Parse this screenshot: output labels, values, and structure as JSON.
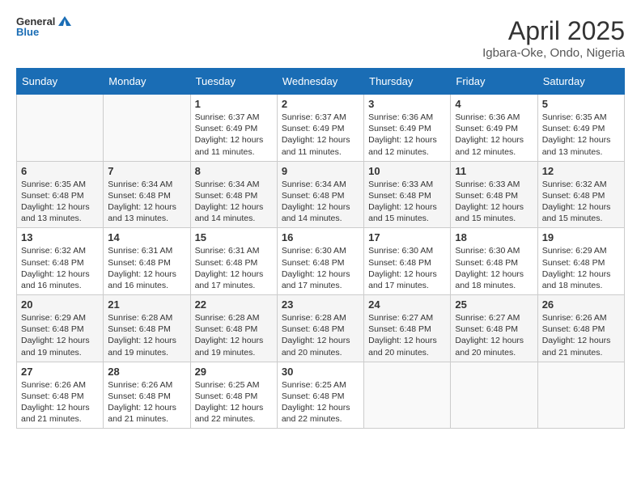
{
  "header": {
    "logo_line1": "General",
    "logo_line2": "Blue",
    "month_title": "April 2025",
    "subtitle": "Igbara-Oke, Ondo, Nigeria"
  },
  "weekdays": [
    "Sunday",
    "Monday",
    "Tuesday",
    "Wednesday",
    "Thursday",
    "Friday",
    "Saturday"
  ],
  "weeks": [
    [
      {
        "day": "",
        "info": ""
      },
      {
        "day": "",
        "info": ""
      },
      {
        "day": "1",
        "info": "Sunrise: 6:37 AM\nSunset: 6:49 PM\nDaylight: 12 hours and 11 minutes."
      },
      {
        "day": "2",
        "info": "Sunrise: 6:37 AM\nSunset: 6:49 PM\nDaylight: 12 hours and 11 minutes."
      },
      {
        "day": "3",
        "info": "Sunrise: 6:36 AM\nSunset: 6:49 PM\nDaylight: 12 hours and 12 minutes."
      },
      {
        "day": "4",
        "info": "Sunrise: 6:36 AM\nSunset: 6:49 PM\nDaylight: 12 hours and 12 minutes."
      },
      {
        "day": "5",
        "info": "Sunrise: 6:35 AM\nSunset: 6:49 PM\nDaylight: 12 hours and 13 minutes."
      }
    ],
    [
      {
        "day": "6",
        "info": "Sunrise: 6:35 AM\nSunset: 6:48 PM\nDaylight: 12 hours and 13 minutes."
      },
      {
        "day": "7",
        "info": "Sunrise: 6:34 AM\nSunset: 6:48 PM\nDaylight: 12 hours and 13 minutes."
      },
      {
        "day": "8",
        "info": "Sunrise: 6:34 AM\nSunset: 6:48 PM\nDaylight: 12 hours and 14 minutes."
      },
      {
        "day": "9",
        "info": "Sunrise: 6:34 AM\nSunset: 6:48 PM\nDaylight: 12 hours and 14 minutes."
      },
      {
        "day": "10",
        "info": "Sunrise: 6:33 AM\nSunset: 6:48 PM\nDaylight: 12 hours and 15 minutes."
      },
      {
        "day": "11",
        "info": "Sunrise: 6:33 AM\nSunset: 6:48 PM\nDaylight: 12 hours and 15 minutes."
      },
      {
        "day": "12",
        "info": "Sunrise: 6:32 AM\nSunset: 6:48 PM\nDaylight: 12 hours and 15 minutes."
      }
    ],
    [
      {
        "day": "13",
        "info": "Sunrise: 6:32 AM\nSunset: 6:48 PM\nDaylight: 12 hours and 16 minutes."
      },
      {
        "day": "14",
        "info": "Sunrise: 6:31 AM\nSunset: 6:48 PM\nDaylight: 12 hours and 16 minutes."
      },
      {
        "day": "15",
        "info": "Sunrise: 6:31 AM\nSunset: 6:48 PM\nDaylight: 12 hours and 17 minutes."
      },
      {
        "day": "16",
        "info": "Sunrise: 6:30 AM\nSunset: 6:48 PM\nDaylight: 12 hours and 17 minutes."
      },
      {
        "day": "17",
        "info": "Sunrise: 6:30 AM\nSunset: 6:48 PM\nDaylight: 12 hours and 17 minutes."
      },
      {
        "day": "18",
        "info": "Sunrise: 6:30 AM\nSunset: 6:48 PM\nDaylight: 12 hours and 18 minutes."
      },
      {
        "day": "19",
        "info": "Sunrise: 6:29 AM\nSunset: 6:48 PM\nDaylight: 12 hours and 18 minutes."
      }
    ],
    [
      {
        "day": "20",
        "info": "Sunrise: 6:29 AM\nSunset: 6:48 PM\nDaylight: 12 hours and 19 minutes."
      },
      {
        "day": "21",
        "info": "Sunrise: 6:28 AM\nSunset: 6:48 PM\nDaylight: 12 hours and 19 minutes."
      },
      {
        "day": "22",
        "info": "Sunrise: 6:28 AM\nSunset: 6:48 PM\nDaylight: 12 hours and 19 minutes."
      },
      {
        "day": "23",
        "info": "Sunrise: 6:28 AM\nSunset: 6:48 PM\nDaylight: 12 hours and 20 minutes."
      },
      {
        "day": "24",
        "info": "Sunrise: 6:27 AM\nSunset: 6:48 PM\nDaylight: 12 hours and 20 minutes."
      },
      {
        "day": "25",
        "info": "Sunrise: 6:27 AM\nSunset: 6:48 PM\nDaylight: 12 hours and 20 minutes."
      },
      {
        "day": "26",
        "info": "Sunrise: 6:26 AM\nSunset: 6:48 PM\nDaylight: 12 hours and 21 minutes."
      }
    ],
    [
      {
        "day": "27",
        "info": "Sunrise: 6:26 AM\nSunset: 6:48 PM\nDaylight: 12 hours and 21 minutes."
      },
      {
        "day": "28",
        "info": "Sunrise: 6:26 AM\nSunset: 6:48 PM\nDaylight: 12 hours and 21 minutes."
      },
      {
        "day": "29",
        "info": "Sunrise: 6:25 AM\nSunset: 6:48 PM\nDaylight: 12 hours and 22 minutes."
      },
      {
        "day": "30",
        "info": "Sunrise: 6:25 AM\nSunset: 6:48 PM\nDaylight: 12 hours and 22 minutes."
      },
      {
        "day": "",
        "info": ""
      },
      {
        "day": "",
        "info": ""
      },
      {
        "day": "",
        "info": ""
      }
    ]
  ]
}
